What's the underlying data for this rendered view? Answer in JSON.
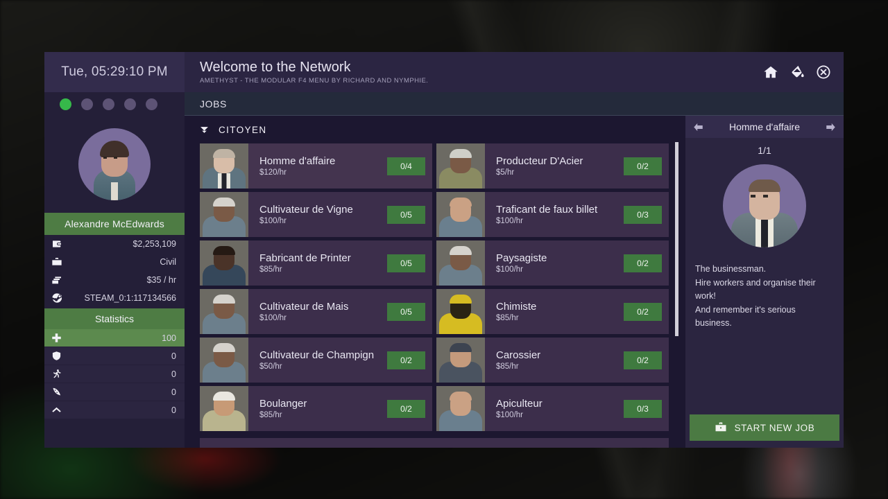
{
  "clock": "Tue, 05:29:10 PM",
  "header": {
    "title": "Welcome to the Network",
    "subtitle": "AMETHYST - THE MODULAR F4 MENU BY RICHARD AND NYMPHIE.",
    "icons": [
      "home-icon",
      "paint-bucket-icon",
      "close-icon"
    ]
  },
  "tabs": [
    {
      "label": "JOBS",
      "active": true
    }
  ],
  "dots": [
    {
      "state": "active"
    },
    {
      "state": "inactive"
    },
    {
      "state": "inactive"
    },
    {
      "state": "inactive"
    },
    {
      "state": "inactive"
    }
  ],
  "player": {
    "name": "Alexandre McEdwards",
    "info": [
      {
        "icon": "wallet-icon",
        "value": "$2,253,109"
      },
      {
        "icon": "briefcase-icon",
        "value": "Civil"
      },
      {
        "icon": "money-icon",
        "value": "$35 / hr"
      },
      {
        "icon": "steam-icon",
        "value": "STEAM_0:1:117134566"
      }
    ],
    "statistics_label": "Statistics",
    "stats": [
      {
        "icon": "health-cross-icon",
        "value": "100",
        "percent": 100
      },
      {
        "icon": "shield-icon",
        "value": "0",
        "percent": 0
      },
      {
        "icon": "running-icon",
        "value": "0",
        "percent": 0
      },
      {
        "icon": "pizza-icon",
        "value": "0",
        "percent": 0
      },
      {
        "icon": "chevron-up-icon",
        "value": "0",
        "percent": 0
      }
    ]
  },
  "jobs_panel": {
    "category": "CITOYEN",
    "jobs": [
      {
        "name": "Homme d'affaire",
        "pay": "$120/hr",
        "slots": "0/4",
        "selected": true,
        "skin": "#5f7480",
        "face": "#d8bda8",
        "hair": "#bfb3a4",
        "attire": "suit"
      },
      {
        "name": "Producteur D'Acier",
        "pay": "$5/hr",
        "slots": "0/2",
        "selected": false,
        "skin": "#8a8b62",
        "face": "#7a5a46",
        "hair": "#cfcfc8",
        "attire": "plain"
      },
      {
        "name": "Cultivateur de Vigne",
        "pay": "$100/hr",
        "slots": "0/5",
        "selected": false,
        "skin": "#6c7f8c",
        "face": "#7a5a46",
        "hair": "#d5d2cc",
        "attire": "plain"
      },
      {
        "name": "Traficant de faux billet",
        "pay": "$100/hr",
        "slots": "0/3",
        "selected": false,
        "skin": "#6a7f8e",
        "face": "#caa184",
        "hair": "#caa184",
        "attire": "plain"
      },
      {
        "name": "Fabricant de Printer",
        "pay": "$85/hr",
        "slots": "0/5",
        "selected": false,
        "skin": "#35475a",
        "face": "#4a3328",
        "hair": "#251a14",
        "attire": "plain"
      },
      {
        "name": "Paysagiste",
        "pay": "$100/hr",
        "slots": "0/2",
        "selected": false,
        "skin": "#6c7f8c",
        "face": "#7a5a46",
        "hair": "#d5d2cc",
        "attire": "plain"
      },
      {
        "name": "Cultivateur de Mais",
        "pay": "$100/hr",
        "slots": "0/5",
        "selected": false,
        "skin": "#6c7f8c",
        "face": "#7a5a46",
        "hair": "#d5d2cc",
        "attire": "plain"
      },
      {
        "name": "Chimiste",
        "pay": "$85/hr",
        "slots": "0/2",
        "selected": false,
        "skin": "#d6bc22",
        "face": "#2a2414",
        "hair": "#d6bc22",
        "attire": "hood"
      },
      {
        "name": "Cultivateur de Champign",
        "pay": "$50/hr",
        "slots": "0/2",
        "selected": false,
        "skin": "#6c7f8c",
        "face": "#7a5a46",
        "hair": "#d5d2cc",
        "attire": "plain"
      },
      {
        "name": "Carossier",
        "pay": "$85/hr",
        "slots": "0/2",
        "selected": false,
        "skin": "#4a5360",
        "face": "#c49a7c",
        "hair": "#3d4450",
        "attire": "beanie"
      },
      {
        "name": "Boulanger",
        "pay": "$85/hr",
        "slots": "0/2",
        "selected": false,
        "skin": "#b9b48e",
        "face": "#c79a76",
        "hair": "#e9e7e0",
        "attire": "chefhat"
      },
      {
        "name": "Apiculteur",
        "pay": "$100/hr",
        "slots": "0/3",
        "selected": false,
        "skin": "#6a7f8e",
        "face": "#caa184",
        "hair": "#caa184",
        "attire": "plain"
      }
    ]
  },
  "detail": {
    "title": "Homme d'affaire",
    "count": "1/1",
    "description": "The businessman.\nHire workers and organise their work!\nAnd remember it's serious business.",
    "button_label": "START NEW JOB"
  },
  "colors": {
    "green_accent": "#4e7c44",
    "badge_green": "#3f7a3f",
    "panel_purple": "#2b2540",
    "dark_purple": "#1c1730",
    "dot_active": "#36b94a"
  }
}
